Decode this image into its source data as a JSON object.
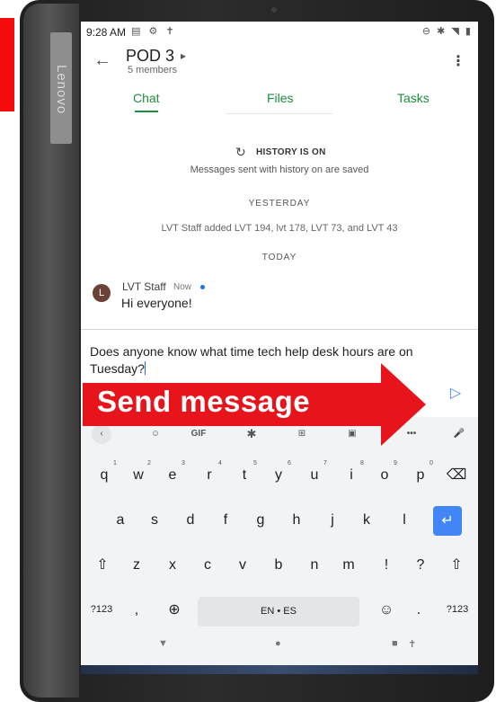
{
  "status_bar": {
    "time": "9:28 AM",
    "left_icons": "▤ ⚙ ✝",
    "right_icons": "⊖ ✱ ◥ ▮"
  },
  "device": {
    "brand": "Lenovo"
  },
  "header": {
    "title": "POD 3",
    "caret": "▸",
    "members": "5 members",
    "back_icon": "←",
    "more_icon": "⋮"
  },
  "tabs": [
    {
      "label": "Chat"
    },
    {
      "label": "Files"
    },
    {
      "label": "Tasks"
    }
  ],
  "history": {
    "icon": "↻",
    "title": "HISTORY IS ON",
    "subtitle": "Messages sent with history on are saved"
  },
  "timeline": {
    "yesterday": "YESTERDAY",
    "system_message": "LVT Staff added LVT 194, lvt 178, LVT 73, and LVT 43",
    "today": "TODAY"
  },
  "message": {
    "avatar": "L",
    "sender": "LVT Staff",
    "time": "Now",
    "text": "Hi everyone!"
  },
  "composer": {
    "text": "Does anyone know what time tech help desk hours are on Tuesday?",
    "send_icon": "▷"
  },
  "annotation": {
    "label": "Send message",
    "color": "#e8141b"
  },
  "keyboard": {
    "toolbar": {
      "back": "‹",
      "emoji": "☺",
      "gif": "GIF",
      "settings": "✱",
      "translate": "⊞",
      "clipboard": "▣",
      "more": "•••",
      "mic": "🎤"
    },
    "row1": [
      "q",
      "w",
      "e",
      "r",
      "t",
      "y",
      "u",
      "i",
      "o",
      "p"
    ],
    "row1_hints": [
      "1",
      "2",
      "3",
      "4",
      "5",
      "6",
      "7",
      "8",
      "9",
      "0"
    ],
    "row1_backspace": "⌫",
    "row2": [
      "a",
      "s",
      "d",
      "f",
      "g",
      "h",
      "j",
      "k",
      "l"
    ],
    "row2_enter": "↵",
    "row3": [
      "⇧",
      "z",
      "x",
      "c",
      "v",
      "b",
      "n",
      "m",
      "!",
      "?",
      "⇧"
    ],
    "row4": {
      "sym_left": "?123",
      "comma": ",",
      "globe": "⊕",
      "space": "EN • ES",
      "emoji": "☺",
      "period": ".",
      "sym_right": "?123"
    }
  },
  "nav_bar": {
    "back": "▼",
    "home": "●",
    "recents": "■",
    "accessibility": "✝"
  }
}
